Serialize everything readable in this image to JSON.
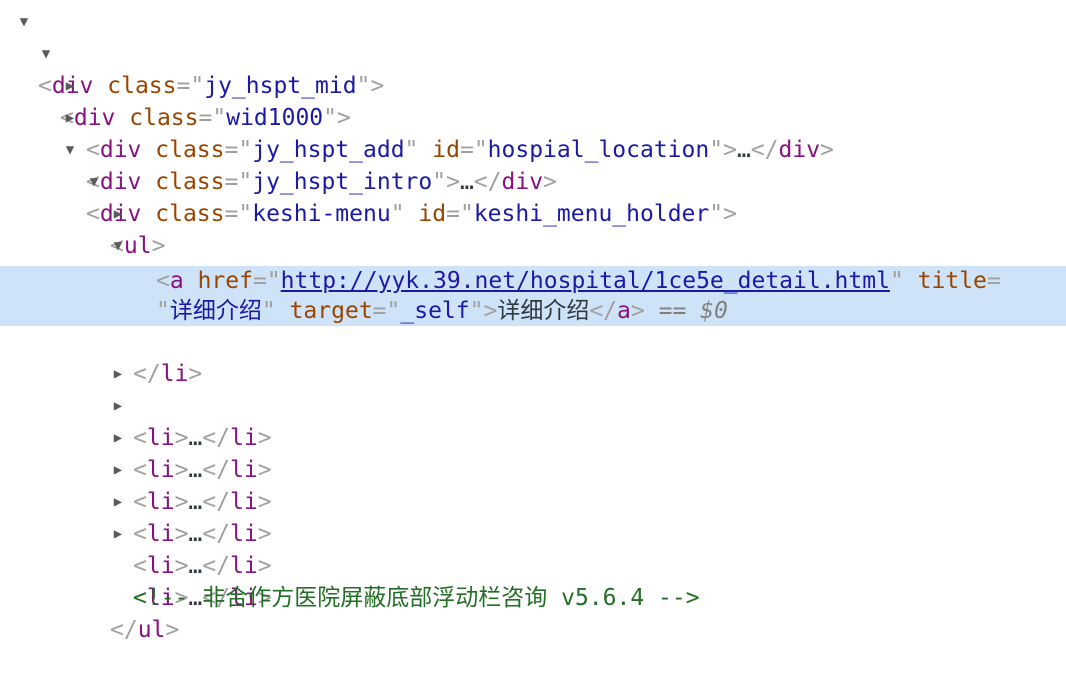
{
  "panel": "elements",
  "nodes": {
    "n0": {
      "tag": "div",
      "attr1": "class",
      "val1": "jy_hspt_mid"
    },
    "n1": {
      "tag": "div",
      "attr1": "class",
      "val1": "wid1000"
    },
    "n2": {
      "tag": "div",
      "attr1": "class",
      "val1": "jy_hspt_add",
      "attr2": "id",
      "val2": "hospial_location",
      "ellipsis": "…"
    },
    "n3": {
      "tag": "div",
      "attr1": "class",
      "val1": "jy_hspt_intro",
      "ellipsis": "…"
    },
    "n4": {
      "tag": "div",
      "attr1": "class",
      "val1": "keshi-menu",
      "attr2": "id",
      "val2": "keshi_menu_holder"
    },
    "n5": {
      "tag": "ul"
    },
    "n6": {
      "tag": "li",
      "ellipsis": "…"
    },
    "n7": {
      "tag": "li"
    },
    "n8": {
      "tag": "a",
      "attr1": "href",
      "val1": "http://yyk.39.net/hospital/1ce5e_detail.html",
      "attr2": "title",
      "val2": "详细介绍",
      "attr3": "target",
      "val3": "_self",
      "text": "详细介绍",
      "marker": "==",
      "var": "$0"
    },
    "n9": {
      "tag": "li"
    },
    "n10": {
      "tag": "li",
      "ellipsis": "…"
    },
    "n11": {
      "tag": "li",
      "ellipsis": "…"
    },
    "n12": {
      "tag": "li",
      "ellipsis": "…"
    },
    "n13": {
      "tag": "li",
      "ellipsis": "…"
    },
    "n14": {
      "tag": "li",
      "ellipsis": "…"
    },
    "n15": {
      "tag": "li",
      "ellipsis": "…"
    },
    "n16": {
      "comment": "非合作方医院屏蔽底部浮动栏咨询 v5.6.4"
    },
    "n17": {
      "tag": "ul"
    }
  },
  "colors": {
    "tag": "#881280",
    "attr_name": "#994500",
    "attr_value": "#1a1aa6",
    "comment": "#236e25",
    "selection": "#cfe3f8"
  }
}
